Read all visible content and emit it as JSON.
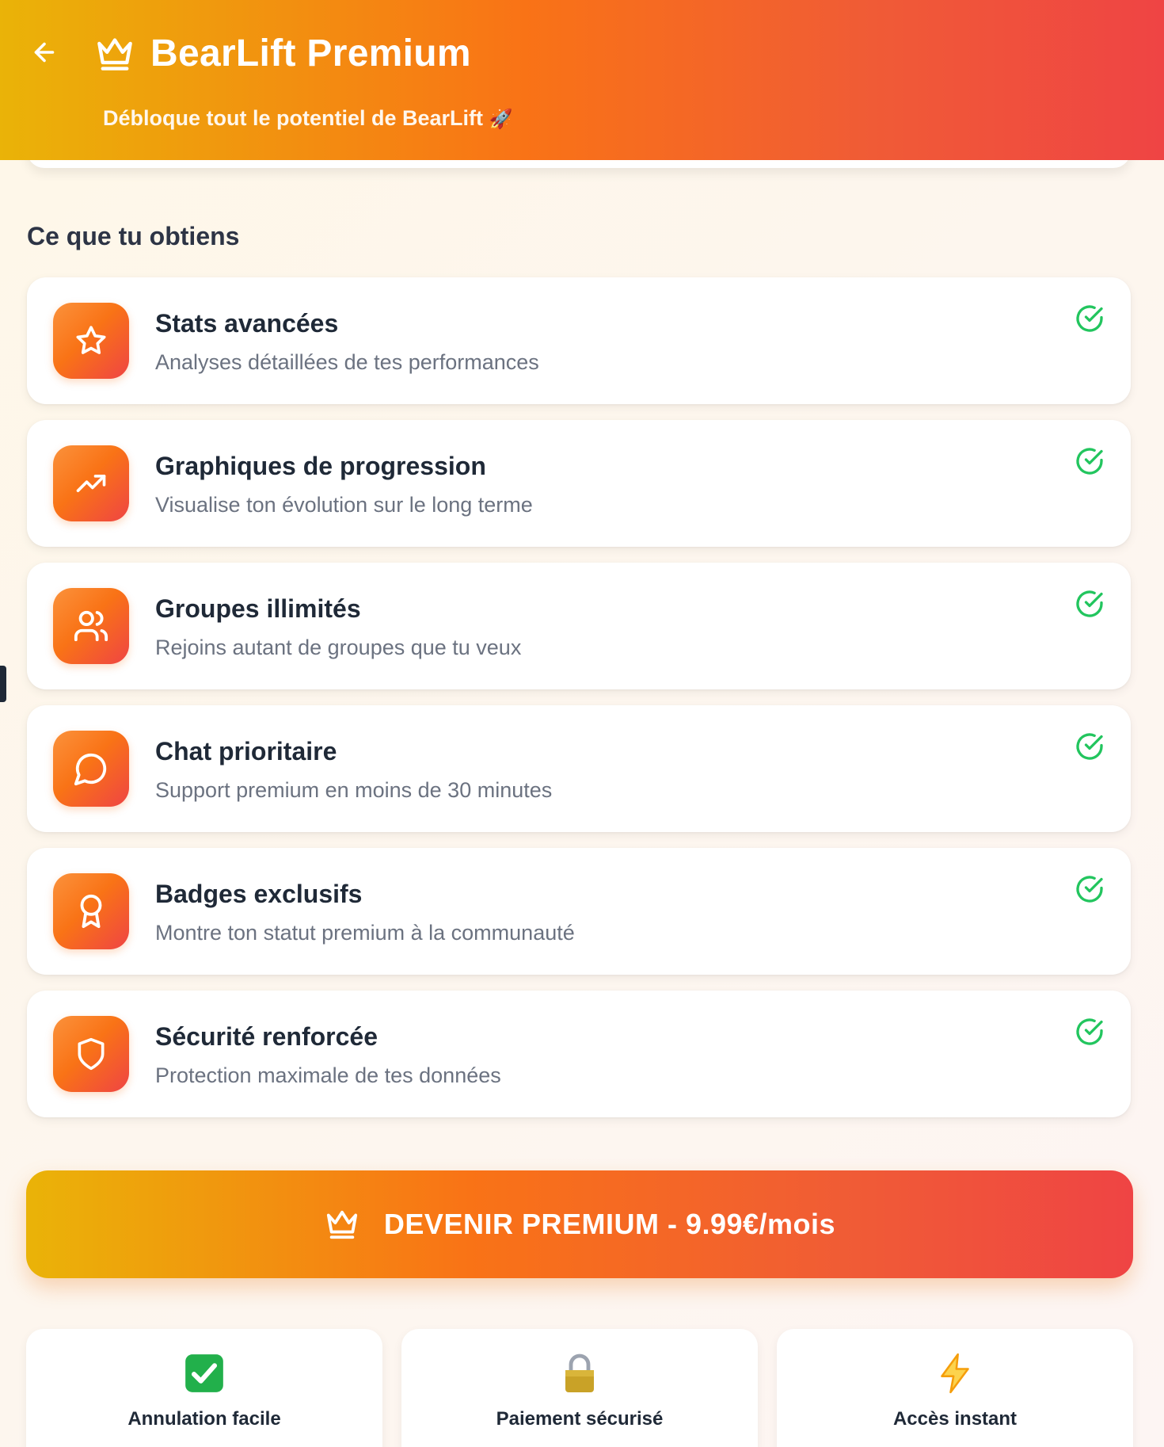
{
  "header": {
    "title": "BearLift Premium",
    "subtitle": "Débloque tout le potentiel de BearLift",
    "subtitle_emoji": "🚀",
    "back_icon": "arrow-left-icon",
    "crown_icon": "crown-icon"
  },
  "section_title": "Ce que tu obtiens",
  "features": [
    {
      "title": "Stats avancées",
      "description": "Analyses détaillées de tes performances",
      "icon": "star-icon"
    },
    {
      "title": "Graphiques de progression",
      "description": "Visualise ton évolution sur le long terme",
      "icon": "trending-up-icon"
    },
    {
      "title": "Groupes illimités",
      "description": "Rejoins autant de groupes que tu veux",
      "icon": "users-icon"
    },
    {
      "title": "Chat prioritaire",
      "description": "Support premium en moins de 30 minutes",
      "icon": "message-circle-icon"
    },
    {
      "title": "Badges exclusifs",
      "description": "Montre ton statut premium à la communauté",
      "icon": "award-icon"
    },
    {
      "title": "Sécurité renforcée",
      "description": "Protection maximale de tes données",
      "icon": "shield-icon"
    }
  ],
  "cta": {
    "label": "DEVENIR PREMIUM - 9.99€/mois",
    "icon": "crown-icon"
  },
  "badges": [
    {
      "label": "Annulation facile",
      "emoji": "✅"
    },
    {
      "label": "Paiement sécurisé",
      "emoji": "🔒"
    },
    {
      "label": "Accès instant",
      "emoji": "⚡"
    }
  ],
  "colors": {
    "gradient_start": "#eab308",
    "gradient_mid": "#f97316",
    "gradient_end": "#ef4444",
    "check_green": "#22c55e",
    "title_text": "#1f2937",
    "desc_text": "#6b7280"
  }
}
